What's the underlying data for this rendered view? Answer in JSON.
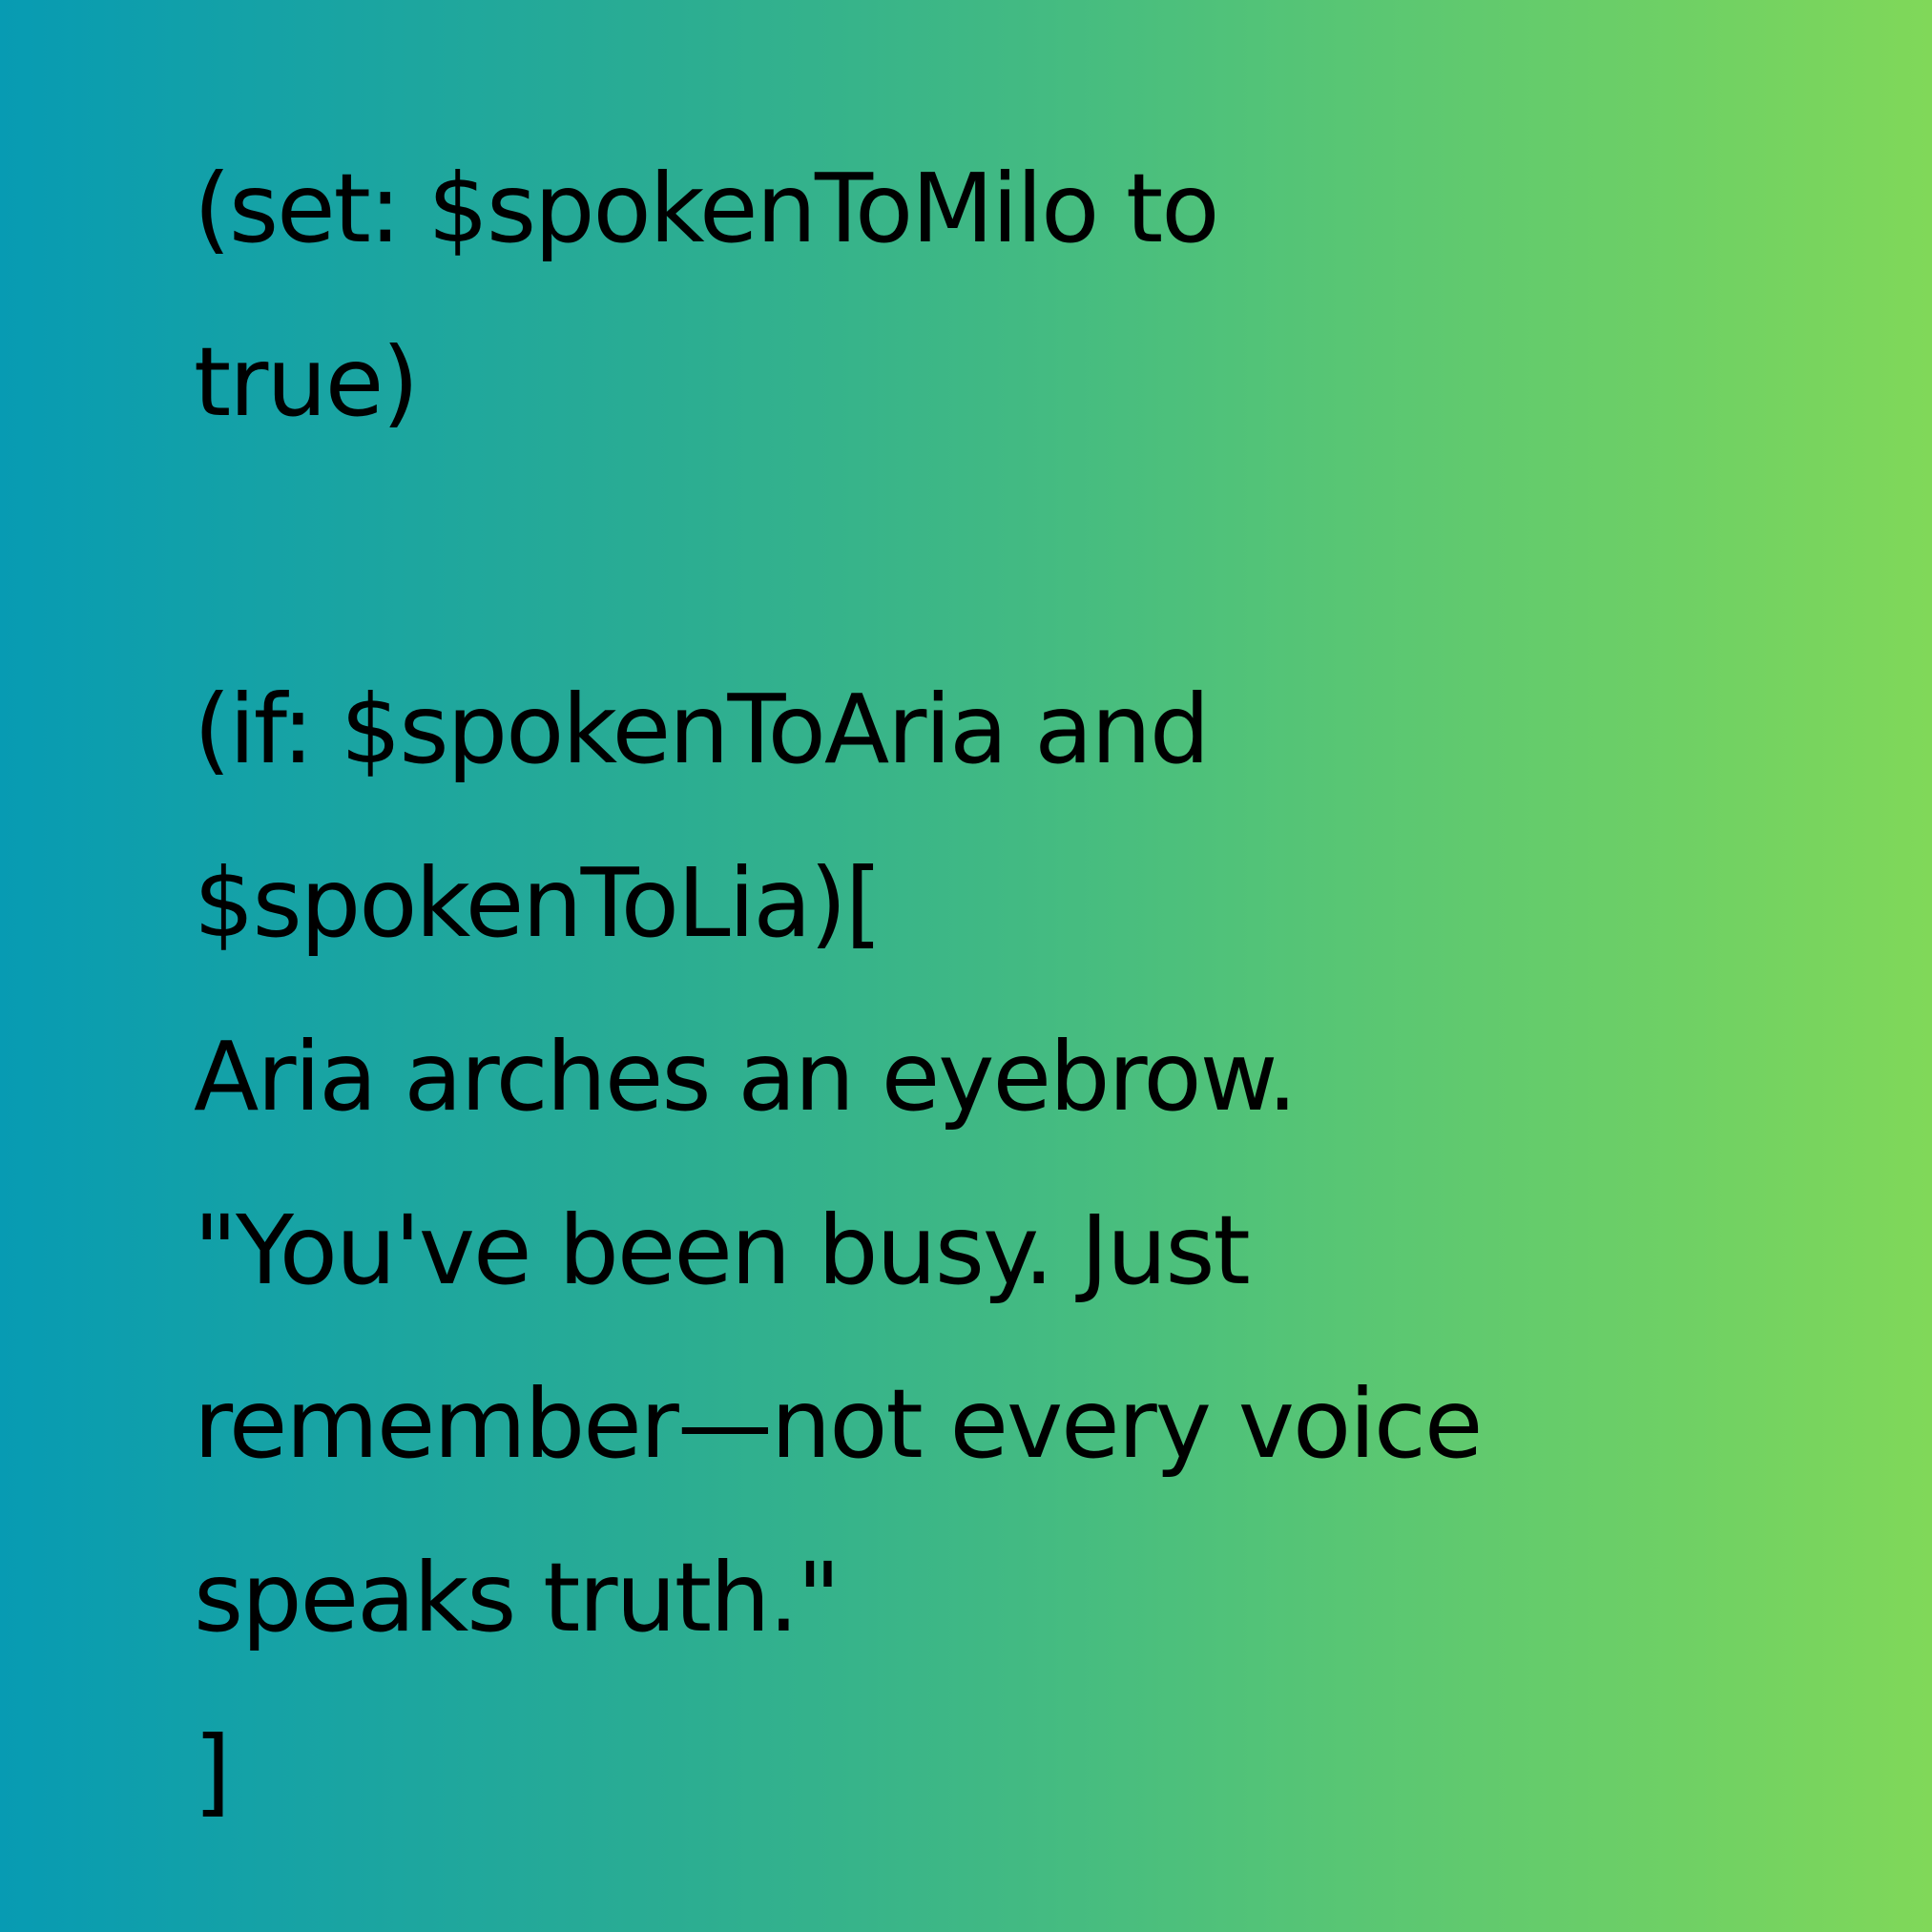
{
  "passage": {
    "lines": [
      "(set: $spokenToMilo to",
      "true)",
      "",
      "(if: $spokenToAria and",
      "$spokenToLia)[",
      "Aria arches an eyebrow.",
      "\"You've been busy. Just",
      "remember—not every voice",
      "speaks truth.\"",
      "]"
    ]
  },
  "colors": {
    "gradient_start": "#079bb3",
    "gradient_end": "#80d859",
    "text": "#000000"
  }
}
